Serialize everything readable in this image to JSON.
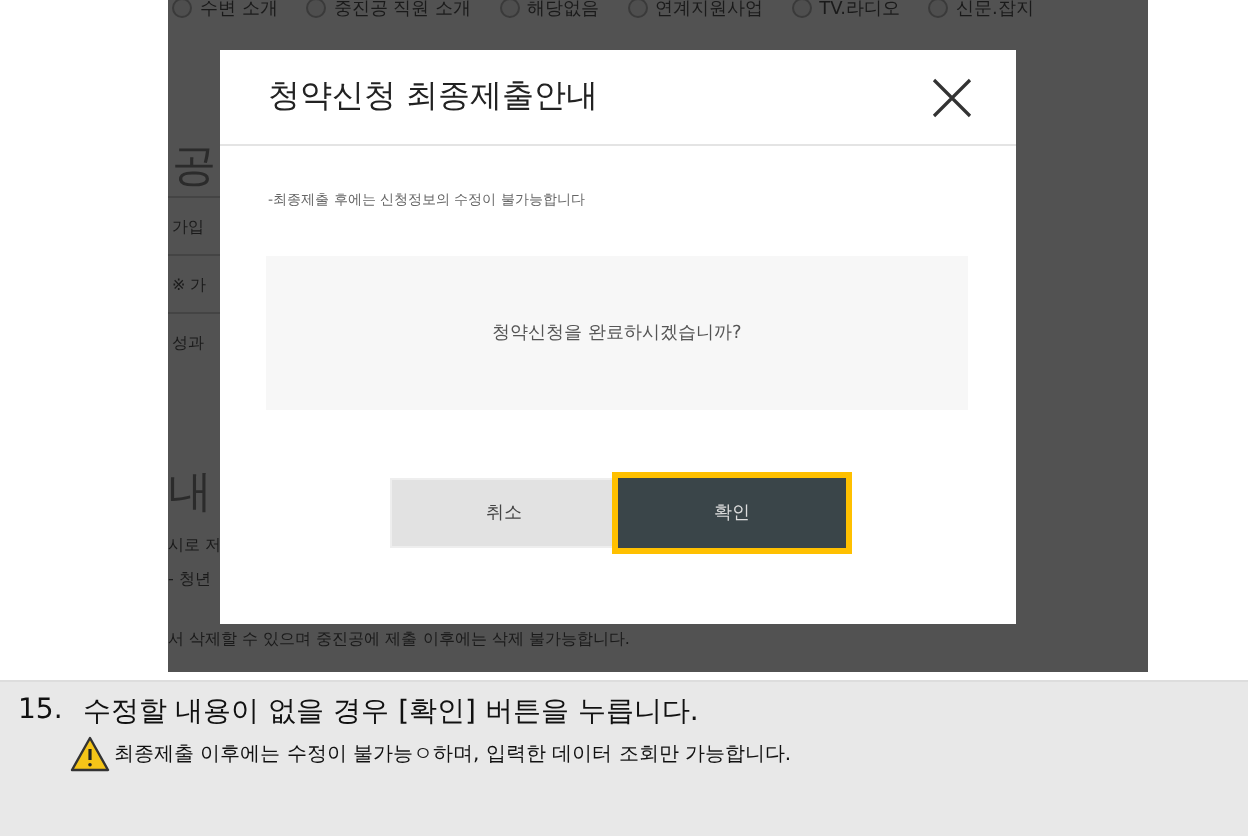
{
  "background_page": {
    "radio_options": [
      {
        "label": "수변 소개",
        "selected": false
      },
      {
        "label": "중진공 직원 소개",
        "selected": false
      },
      {
        "label": "해당없음",
        "selected": false
      },
      {
        "label": "연계지원사업",
        "selected": false
      },
      {
        "label": "TV.라디오",
        "selected": false
      },
      {
        "label": "신문.잡지",
        "selected": false
      }
    ],
    "heading": "공",
    "rows": [
      "가입",
      "※ 가",
      "성과"
    ],
    "section_heading": "내",
    "lines": [
      "시로 저",
      "- 청년",
      "서 삭제할 수 있으며 중진공에 제출 이후에는 삭제 불가능합니다."
    ]
  },
  "dialog": {
    "title": "청약신청 최종제출안내",
    "note": "-최종제출 후에는 신청정보의 수정이 불가능합니다",
    "question": "청약신청을 완료하시겠습니까?",
    "buttons": [
      {
        "label": "취소",
        "kind": "secondary",
        "highlighted": false
      },
      {
        "label": "확인",
        "kind": "primary",
        "highlighted": true
      }
    ]
  },
  "caption": {
    "number": "15.",
    "text": "수정할 내용이 없을 경우 [확인] 버튼을 누릅니다.",
    "warning": "최종제출 이후에는 수정이 불가능ㅇ하며, 입력한 데이터 조회만 가능합니다."
  }
}
